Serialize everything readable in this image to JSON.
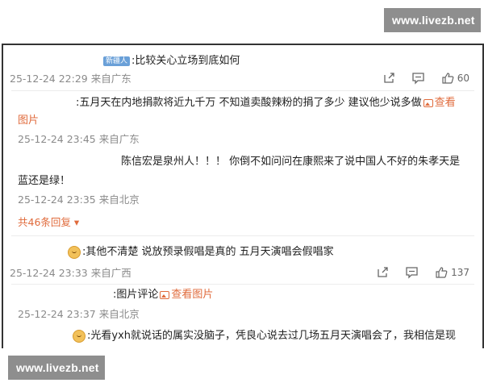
{
  "watermark": {
    "top": "www.livezb.net",
    "bottom": "www.livezb.net"
  },
  "comments": [
    {
      "badge": "新疆人",
      "text": ":比较关心立场到底如何",
      "time": "25-12-24 22:29 来自广东",
      "likes": "60"
    },
    {
      "text": ":五月天在内地捐款将近九千万 不知道卖酸辣粉的捐了多少 建议他少说多做",
      "link": "查看图片",
      "time": "25-12-24 23:45 来自广东"
    },
    {
      "text_line1": "陈信宏是泉州人！！！ 你倒不如问问在康熙来了说中国人不好的朱孝天是",
      "text_line2": "蓝还是绿！",
      "time": "25-12-24 23:35 来自北京"
    },
    {
      "more": "共46条回复"
    },
    {
      "text": ":其他不清楚 说放预录假唱是真的 五月天演唱会假唱家",
      "time": "25-12-24 23:33 来自广西",
      "likes": "137"
    },
    {
      "text": ":图片评论",
      "link": "查看图片",
      "time": "25-12-24 23:37 来自北京"
    },
    {
      "text": ":光看yxh就说话的属实没脑子，凭良心说去过几场五月天演唱会了，我相信是现"
    }
  ]
}
